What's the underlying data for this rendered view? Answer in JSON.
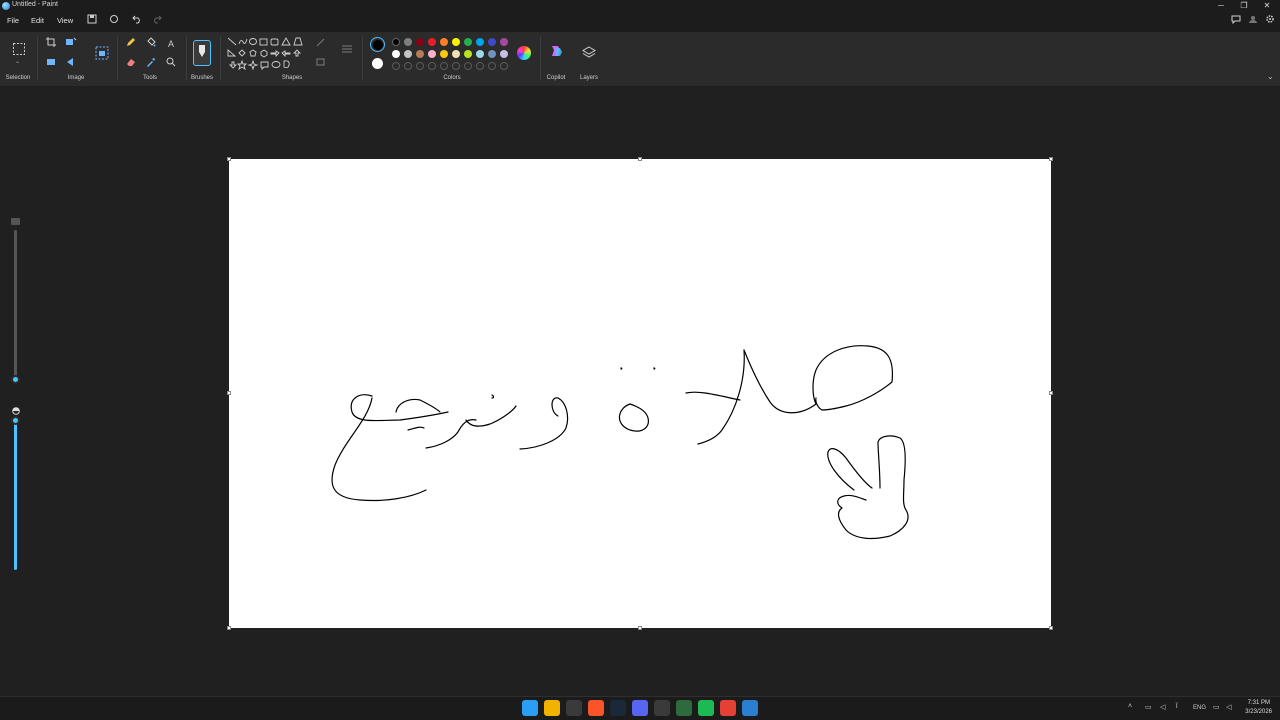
{
  "window": {
    "title": "Untitled - Paint",
    "controls": [
      "─",
      "❐",
      "✕"
    ]
  },
  "menu": {
    "file": "File",
    "edit": "Edit",
    "view": "View"
  },
  "ribbon": {
    "groups": {
      "selection": "Selection",
      "image": "Image",
      "tools": "Tools",
      "brushes": "Brushes",
      "shapes": "Shapes",
      "colors": "Colors",
      "copilot": "Copilot",
      "layers": "Layers"
    },
    "tools_text_tool": "A",
    "current_color": "#000000",
    "secondary_color": "#ffffff",
    "palette_row1": [
      "#000000",
      "#7f7f7f",
      "#880015",
      "#ed1c24",
      "#ff7f27",
      "#fff200",
      "#22b14c",
      "#00a2e8",
      "#3f48cc",
      "#a349a4"
    ],
    "palette_row2": [
      "#ffffff",
      "#c3c3c3",
      "#b97a57",
      "#ffaec9",
      "#ffc90e",
      "#efe4b0",
      "#b5e61d",
      "#99d9ea",
      "#7092be",
      "#c8bfe7"
    ],
    "palette_row3_empty_count": 10
  },
  "taskbar": {
    "apps": [
      {
        "name": "start-icon",
        "color": "#2a9df4"
      },
      {
        "name": "file-explorer-icon",
        "color": "#f2b200"
      },
      {
        "name": "calendar-icon",
        "color": "#3a3a3a"
      },
      {
        "name": "brave-icon",
        "color": "#fb542b"
      },
      {
        "name": "steam-icon",
        "color": "#1b2838"
      },
      {
        "name": "discord-icon",
        "color": "#5865f2"
      },
      {
        "name": "terminal-icon",
        "color": "#3a3a3a"
      },
      {
        "name": "photo-icon",
        "color": "#2d6a3e"
      },
      {
        "name": "spotify-icon",
        "color": "#1db954"
      },
      {
        "name": "chrome-icon",
        "color": "#e44134"
      },
      {
        "name": "paint-icon",
        "color": "#2a7fd1"
      }
    ],
    "tray": {
      "language": "ENG",
      "time": "7:31 PM",
      "date": "3/23/2026"
    }
  }
}
